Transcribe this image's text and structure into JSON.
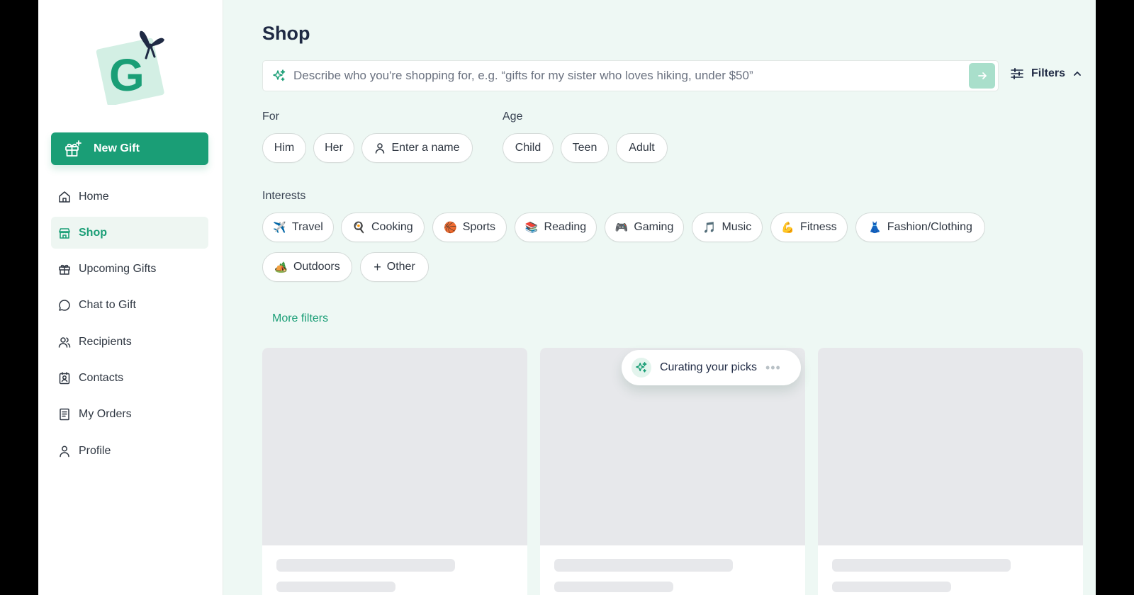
{
  "colors": {
    "brand": "#1a9e76",
    "page_bg": "#eef8f4",
    "sidebar_bg": "#ffffff",
    "heading": "#1f2a44",
    "skeleton": "#e7e8eb"
  },
  "sidebar": {
    "logo_icon": "gift-tag-logo",
    "new_gift_label": "New Gift",
    "items": [
      {
        "label": "Home",
        "icon": "home-icon"
      },
      {
        "label": "Shop",
        "icon": "shop-icon",
        "active": true
      },
      {
        "label": "Upcoming Gifts",
        "icon": "gift-icon"
      },
      {
        "label": "Chat to Gift",
        "icon": "chat-icon"
      },
      {
        "label": "Recipients",
        "icon": "recipients-icon"
      },
      {
        "label": "Contacts",
        "icon": "contacts-icon"
      },
      {
        "label": "My Orders",
        "icon": "orders-icon"
      },
      {
        "label": "Profile",
        "icon": "profile-icon"
      }
    ]
  },
  "main": {
    "title": "Shop",
    "search": {
      "placeholder": "Describe who you're shopping for, e.g. “gifts for my sister who loves hiking, under $50”"
    },
    "filters_toggle_label": "Filters",
    "for": {
      "label": "For",
      "chips": [
        "Him",
        "Her",
        "Enter a name"
      ]
    },
    "age": {
      "label": "Age",
      "chips": [
        "Child",
        "Teen",
        "Adult"
      ]
    },
    "interests": {
      "label": "Interests",
      "chips": [
        {
          "label": "Travel",
          "icon": "✈️"
        },
        {
          "label": "Cooking",
          "icon": "🍳"
        },
        {
          "label": "Sports",
          "icon": "🏀"
        },
        {
          "label": "Reading",
          "icon": "📚"
        },
        {
          "label": "Gaming",
          "icon": "🎮"
        },
        {
          "label": "Music",
          "icon": "🎵"
        },
        {
          "label": "Fitness",
          "icon": "💪"
        },
        {
          "label": "Fashion/Clothing",
          "icon": "👗"
        },
        {
          "label": "Outdoors",
          "icon": "🏕️"
        },
        {
          "label": "Other",
          "icon": "+"
        }
      ]
    },
    "more_filters_label": "More filters",
    "curating_label": "Curating your picks",
    "curating_dots": "•••"
  }
}
